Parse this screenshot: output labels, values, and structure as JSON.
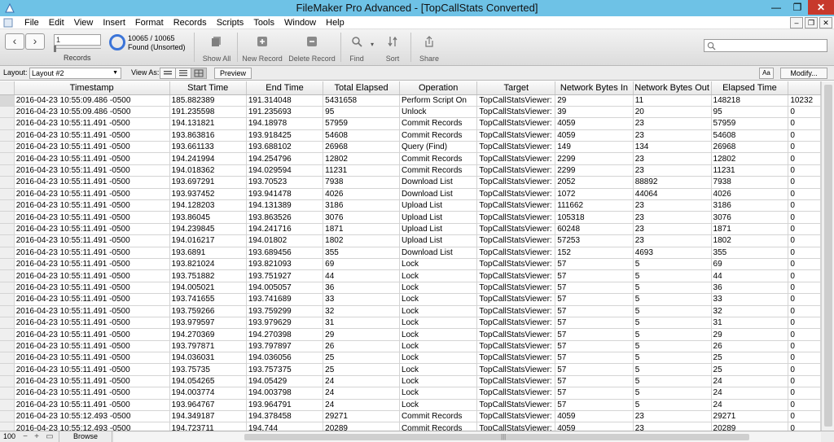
{
  "window": {
    "title": "FileMaker Pro Advanced - [TopCallStats Converted]",
    "min_glyph": "—",
    "max_glyph": "❐",
    "close_glyph": "✕"
  },
  "menu": [
    "File",
    "Edit",
    "View",
    "Insert",
    "Format",
    "Records",
    "Scripts",
    "Tools",
    "Window",
    "Help"
  ],
  "toolbar": {
    "prev_glyph": "‹",
    "next_glyph": "›",
    "record_input": "1",
    "records_label": "Records",
    "found_count": "10065 / 10065",
    "found_status": "Found (Unsorted)",
    "show_all": "Show All",
    "new_record": "New Record",
    "delete_record": "Delete Record",
    "find": "Find",
    "sort": "Sort",
    "share": "Share"
  },
  "layoutbar": {
    "layout_label": "Layout:",
    "layout_value": "Layout #2",
    "view_as_label": "View As:",
    "preview": "Preview",
    "aa": "Aa",
    "modify": "Modify..."
  },
  "table": {
    "columns": [
      "Timestamp",
      "Start Time",
      "End Time",
      "Total Elapsed",
      "Operation",
      "Target",
      "Network Bytes In",
      "Network Bytes Out",
      "Elapsed Time",
      ""
    ],
    "rows": [
      [
        "2016-04-23 10:55:09.486 -0500",
        "185.882389",
        "191.314048",
        "5431658",
        "Perform Script On",
        "TopCallStatsViewer:",
        "29",
        "11",
        "148218",
        "10232"
      ],
      [
        "2016-04-23 10:55:09.486 -0500",
        "191.235598",
        "191.235693",
        "95",
        "Unlock",
        "TopCallStatsViewer:",
        "39",
        "20",
        "95",
        "0"
      ],
      [
        "2016-04-23 10:55:11.491 -0500",
        "194.131821",
        "194.18978",
        "57959",
        "Commit Records",
        "TopCallStatsViewer:",
        "4059",
        "23",
        "57959",
        "0"
      ],
      [
        "2016-04-23 10:55:11.491 -0500",
        "193.863816",
        "193.918425",
        "54608",
        "Commit Records",
        "TopCallStatsViewer:",
        "4059",
        "23",
        "54608",
        "0"
      ],
      [
        "2016-04-23 10:55:11.491 -0500",
        "193.661133",
        "193.688102",
        "26968",
        "Query (Find)",
        "TopCallStatsViewer:",
        "149",
        "134",
        "26968",
        "0"
      ],
      [
        "2016-04-23 10:55:11.491 -0500",
        "194.241994",
        "194.254796",
        "12802",
        "Commit Records",
        "TopCallStatsViewer:",
        "2299",
        "23",
        "12802",
        "0"
      ],
      [
        "2016-04-23 10:55:11.491 -0500",
        "194.018362",
        "194.029594",
        "11231",
        "Commit Records",
        "TopCallStatsViewer:",
        "2299",
        "23",
        "11231",
        "0"
      ],
      [
        "2016-04-23 10:55:11.491 -0500",
        "193.697291",
        "193.70523",
        "7938",
        "Download List",
        "TopCallStatsViewer:",
        "2052",
        "88892",
        "7938",
        "0"
      ],
      [
        "2016-04-23 10:55:11.491 -0500",
        "193.937452",
        "193.941478",
        "4026",
        "Download List",
        "TopCallStatsViewer:",
        "1072",
        "44064",
        "4026",
        "0"
      ],
      [
        "2016-04-23 10:55:11.491 -0500",
        "194.128203",
        "194.131389",
        "3186",
        "Upload List",
        "TopCallStatsViewer:",
        "111662",
        "23",
        "3186",
        "0"
      ],
      [
        "2016-04-23 10:55:11.491 -0500",
        "193.86045",
        "193.863526",
        "3076",
        "Upload List",
        "TopCallStatsViewer:",
        "105318",
        "23",
        "3076",
        "0"
      ],
      [
        "2016-04-23 10:55:11.491 -0500",
        "194.239845",
        "194.241716",
        "1871",
        "Upload List",
        "TopCallStatsViewer:",
        "60248",
        "23",
        "1871",
        "0"
      ],
      [
        "2016-04-23 10:55:11.491 -0500",
        "194.016217",
        "194.01802",
        "1802",
        "Upload List",
        "TopCallStatsViewer:",
        "57253",
        "23",
        "1802",
        "0"
      ],
      [
        "2016-04-23 10:55:11.491 -0500",
        "193.6891",
        "193.689456",
        "355",
        "Download List",
        "TopCallStatsViewer:",
        "152",
        "4693",
        "355",
        "0"
      ],
      [
        "2016-04-23 10:55:11.491 -0500",
        "193.821024",
        "193.821093",
        "69",
        "Lock",
        "TopCallStatsViewer:",
        "57",
        "5",
        "69",
        "0"
      ],
      [
        "2016-04-23 10:55:11.491 -0500",
        "193.751882",
        "193.751927",
        "44",
        "Lock",
        "TopCallStatsViewer:",
        "57",
        "5",
        "44",
        "0"
      ],
      [
        "2016-04-23 10:55:11.491 -0500",
        "194.005021",
        "194.005057",
        "36",
        "Lock",
        "TopCallStatsViewer:",
        "57",
        "5",
        "36",
        "0"
      ],
      [
        "2016-04-23 10:55:11.491 -0500",
        "193.741655",
        "193.741689",
        "33",
        "Lock",
        "TopCallStatsViewer:",
        "57",
        "5",
        "33",
        "0"
      ],
      [
        "2016-04-23 10:55:11.491 -0500",
        "193.759266",
        "193.759299",
        "32",
        "Lock",
        "TopCallStatsViewer:",
        "57",
        "5",
        "32",
        "0"
      ],
      [
        "2016-04-23 10:55:11.491 -0500",
        "193.979597",
        "193.979629",
        "31",
        "Lock",
        "TopCallStatsViewer:",
        "57",
        "5",
        "31",
        "0"
      ],
      [
        "2016-04-23 10:55:11.491 -0500",
        "194.270369",
        "194.270398",
        "29",
        "Lock",
        "TopCallStatsViewer:",
        "57",
        "5",
        "29",
        "0"
      ],
      [
        "2016-04-23 10:55:11.491 -0500",
        "193.797871",
        "193.797897",
        "26",
        "Lock",
        "TopCallStatsViewer:",
        "57",
        "5",
        "26",
        "0"
      ],
      [
        "2016-04-23 10:55:11.491 -0500",
        "194.036031",
        "194.036056",
        "25",
        "Lock",
        "TopCallStatsViewer:",
        "57",
        "5",
        "25",
        "0"
      ],
      [
        "2016-04-23 10:55:11.491 -0500",
        "193.75735",
        "193.757375",
        "25",
        "Lock",
        "TopCallStatsViewer:",
        "57",
        "5",
        "25",
        "0"
      ],
      [
        "2016-04-23 10:55:11.491 -0500",
        "194.054265",
        "194.05429",
        "24",
        "Lock",
        "TopCallStatsViewer:",
        "57",
        "5",
        "24",
        "0"
      ],
      [
        "2016-04-23 10:55:11.491 -0500",
        "194.003774",
        "194.003798",
        "24",
        "Lock",
        "TopCallStatsViewer:",
        "57",
        "5",
        "24",
        "0"
      ],
      [
        "2016-04-23 10:55:11.491 -0500",
        "193.964767",
        "193.964791",
        "24",
        "Lock",
        "TopCallStatsViewer:",
        "57",
        "5",
        "24",
        "0"
      ],
      [
        "2016-04-23 10:55:12.493 -0500",
        "194.349187",
        "194.378458",
        "29271",
        "Commit Records",
        "TopCallStatsViewer:",
        "4059",
        "23",
        "29271",
        "0"
      ],
      [
        "2016-04-23 10:55:12.493 -0500",
        "194.723711",
        "194.744",
        "20289",
        "Commit Records",
        "TopCallStatsViewer:",
        "4059",
        "23",
        "20289",
        "0"
      ]
    ]
  },
  "bottombar": {
    "zoom": "100",
    "zoom_out_glyph": "−",
    "zoom_in_glyph": "+",
    "mode": "Browse",
    "grip": "|||"
  },
  "icons": {
    "close": "close-icon",
    "record": "record-icon",
    "show_all": "show-all-icon",
    "new_record": "plus-icon",
    "delete_record": "minus-icon",
    "find": "magnifier-icon",
    "sort": "sort-icon",
    "share": "share-icon"
  },
  "colors": {
    "titlebar": "#6ec2e6",
    "close": "#c7392c",
    "found_circle": "#3b74d8"
  }
}
